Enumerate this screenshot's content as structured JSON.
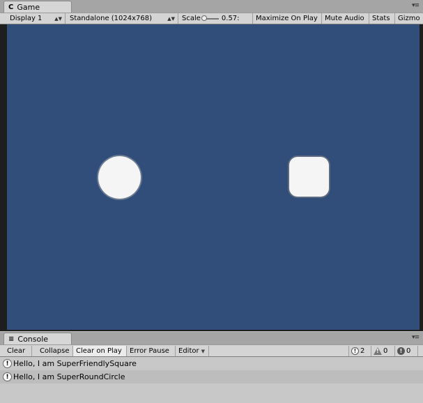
{
  "game_panel": {
    "tab_label": "Game",
    "tab_glyph": "C",
    "menu_glyph": "▾≡",
    "toolbar": {
      "display": "Display 1",
      "resolution": "Standalone (1024x768)",
      "scale_label": "Scale",
      "scale_value": "0.57:",
      "maximize": "Maximize On Play",
      "mute": "Mute Audio",
      "stats": "Stats",
      "gizmos": "Gizmo"
    },
    "viewport_color": "#314d79"
  },
  "console_panel": {
    "tab_label": "Console",
    "tab_glyph": "≡",
    "menu_glyph": "▾≡",
    "toolbar": {
      "clear": "Clear",
      "collapse": "Collapse",
      "clear_on_play": "Clear on Play",
      "error_pause": "Error Pause",
      "editor": "Editor"
    },
    "counts": {
      "info": "2",
      "warning": "0",
      "error": "0"
    },
    "logs": [
      {
        "text": "Hello, I am SuperFriendlySquare",
        "icon": "info-icon"
      },
      {
        "text": "Hello, I am SuperRoundCircle",
        "icon": "info-icon"
      }
    ]
  }
}
